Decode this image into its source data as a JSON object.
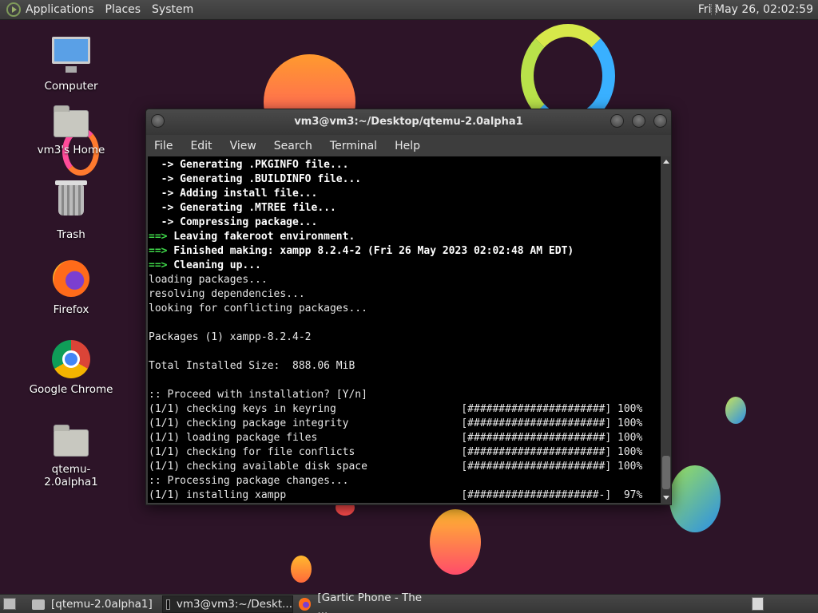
{
  "top_panel": {
    "menus": [
      "Applications",
      "Places",
      "System"
    ],
    "clock": "Fri May 26, 02:02:59"
  },
  "desktop": {
    "icons": [
      {
        "label": "Computer",
        "icon": "computer-icon"
      },
      {
        "label": "vm3's Home",
        "icon": "home-folder-icon"
      },
      {
        "label": "Trash",
        "icon": "trash-icon"
      },
      {
        "label": "Firefox",
        "icon": "firefox-icon"
      },
      {
        "label": "Google Chrome",
        "icon": "chrome-icon"
      },
      {
        "label": "qtemu-2.0alpha1",
        "icon": "folder-icon"
      }
    ]
  },
  "terminal": {
    "title": "vm3@vm3:~/Desktop/qtemu-2.0alpha1",
    "menu": [
      "File",
      "Edit",
      "View",
      "Search",
      "Terminal",
      "Help"
    ],
    "lines": [
      {
        "style": "b",
        "text": "  -> Generating .PKGINFO file..."
      },
      {
        "style": "b",
        "text": "  -> Generating .BUILDINFO file..."
      },
      {
        "style": "b",
        "text": "  -> Adding install file..."
      },
      {
        "style": "b",
        "text": "  -> Generating .MTREE file..."
      },
      {
        "style": "b",
        "text": "  -> Compressing package..."
      },
      {
        "style": "g",
        "prefix": "==>",
        "text": " Leaving fakeroot environment."
      },
      {
        "style": "g",
        "prefix": "==>",
        "text": " Finished making: xampp 8.2.4-2 (Fri 26 May 2023 02:02:48 AM EDT)"
      },
      {
        "style": "g",
        "prefix": "==>",
        "text": " Cleaning up..."
      },
      {
        "style": "n",
        "text": "loading packages..."
      },
      {
        "style": "n",
        "text": "resolving dependencies..."
      },
      {
        "style": "n",
        "text": "looking for conflicting packages..."
      },
      {
        "style": "n",
        "text": ""
      },
      {
        "style": "n",
        "text": "Packages (1) xampp-8.2.4-2"
      },
      {
        "style": "n",
        "text": ""
      },
      {
        "style": "n",
        "text": "Total Installed Size:  888.06 MiB"
      },
      {
        "style": "n",
        "text": ""
      },
      {
        "style": "n",
        "text": ":: Proceed with installation? [Y/n]"
      },
      {
        "style": "n",
        "text": "(1/1) checking keys in keyring                    [######################] 100%"
      },
      {
        "style": "n",
        "text": "(1/1) checking package integrity                  [######################] 100%"
      },
      {
        "style": "n",
        "text": "(1/1) loading package files                       [######################] 100%"
      },
      {
        "style": "n",
        "text": "(1/1) checking for file conflicts                 [######################] 100%"
      },
      {
        "style": "n",
        "text": "(1/1) checking available disk space               [######################] 100%"
      },
      {
        "style": "n",
        "text": ":: Processing package changes..."
      },
      {
        "style": "n",
        "text": "(1/1) installing xampp                            [#####################-]  97%"
      }
    ]
  },
  "taskbar": {
    "tasks": [
      {
        "label": "[qtemu-2.0alpha1]",
        "icon": "folder-icon",
        "active": false
      },
      {
        "label": "vm3@vm3:~/Deskt...",
        "icon": "terminal-icon",
        "active": true
      },
      {
        "label": "[Gartic Phone - The ...",
        "icon": "firefox-icon",
        "active": false
      }
    ]
  }
}
